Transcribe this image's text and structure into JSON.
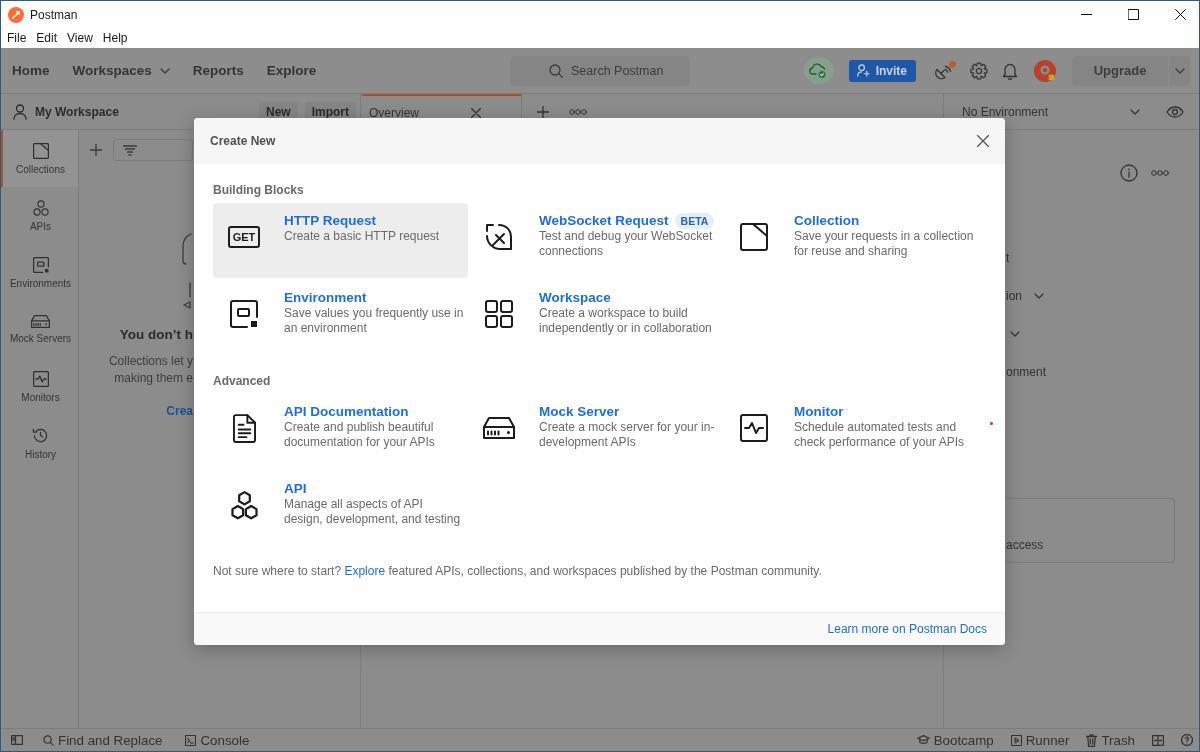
{
  "window": {
    "title": "Postman"
  },
  "menu_bar": [
    "File",
    "Edit",
    "View",
    "Help"
  ],
  "header": {
    "nav": [
      {
        "label": "Home",
        "has_menu": false
      },
      {
        "label": "Workspaces",
        "has_menu": true
      },
      {
        "label": "Reports",
        "has_menu": false
      },
      {
        "label": "Explore",
        "has_menu": false
      }
    ],
    "search": {
      "placeholder": "Search Postman"
    },
    "invite_button": "Invite",
    "upgrade_button": "Upgrade"
  },
  "workspace": {
    "name": "My Workspace",
    "buttons": [
      "New",
      "Import"
    ]
  },
  "tabs": [
    {
      "label": "Overview",
      "selected": true
    }
  ],
  "environment": {
    "value": "No Environment"
  },
  "rail": [
    {
      "label": "Collections",
      "kind": "collections",
      "selected": true
    },
    {
      "label": "APIs",
      "kind": "apis",
      "selected": false
    },
    {
      "label": "Environments",
      "kind": "environments",
      "selected": false
    },
    {
      "label": "Mock Servers",
      "kind": "mock",
      "selected": false
    },
    {
      "label": "Monitors",
      "kind": "monitors",
      "selected": false
    },
    {
      "label": "History",
      "kind": "history",
      "selected": false
    }
  ],
  "sidebar": {
    "empty_title": "You don’t h",
    "empty_text": [
      "Collections let y",
      "making them e"
    ],
    "link": "Crea"
  },
  "right_panel": {
    "rows": [
      {
        "text": "t",
        "has_menu": false
      },
      {
        "text": "ion",
        "has_menu": true
      },
      {
        "has_menu": true
      },
      {
        "text": "onment",
        "has_menu": false
      }
    ],
    "card_text": "access"
  },
  "modal": {
    "title": "Create New",
    "sections": [
      {
        "heading": "Building Blocks",
        "items": [
          {
            "kind": "http",
            "icon_label": "GET",
            "title": "HTTP Request",
            "description": [
              "Create a basic HTTP request"
            ],
            "selected": true
          },
          {
            "kind": "websocket",
            "title": "WebSocket Request",
            "badge": "BETA",
            "description": [
              "Test and debug your WebSocket",
              "connections"
            ],
            "selected": false
          },
          {
            "kind": "collection",
            "title": "Collection",
            "description": [
              "Save your requests in a collection",
              "for reuse and sharing"
            ],
            "selected": false
          },
          {
            "kind": "environment",
            "title": "Environment",
            "description": [
              "Save values you frequently use in",
              "an environment"
            ],
            "selected": false
          },
          {
            "kind": "workspace",
            "title": "Workspace",
            "description": [
              "Create a workspace to build",
              "independently or in collaboration"
            ],
            "selected": false
          }
        ]
      },
      {
        "heading": "Advanced",
        "items": [
          {
            "kind": "documentation",
            "title": "API Documentation",
            "description": [
              "Create and publish beautiful",
              "documentation for your APIs"
            ],
            "selected": false
          },
          {
            "kind": "mock",
            "title": "Mock Server",
            "description": [
              "Create a mock server for your in-",
              "development APIs"
            ],
            "selected": false
          },
          {
            "kind": "monitor",
            "title": "Monitor",
            "description": [
              "Schedule automated tests and",
              "check performance of your APIs"
            ],
            "selected": false
          },
          {
            "kind": "api",
            "title": "API",
            "description": [
              "Manage all aspects of API",
              "design, development, and testing"
            ],
            "selected": false
          }
        ]
      }
    ],
    "help": {
      "before": "Not sure where to start?",
      "link": "Explore",
      "after": "featured APIs, collections, and workspaces published by the Postman community."
    },
    "docs_link": "Learn more on Postman Docs"
  },
  "status_bar": {
    "left": [
      {
        "label": "Find and Replace",
        "kind": "find"
      },
      {
        "label": "Console",
        "kind": "console"
      }
    ],
    "right": [
      {
        "label": "Bootcamp",
        "kind": "bootcamp"
      },
      {
        "label": "Runner",
        "kind": "runner"
      },
      {
        "label": "Trash",
        "kind": "trash"
      }
    ]
  }
}
